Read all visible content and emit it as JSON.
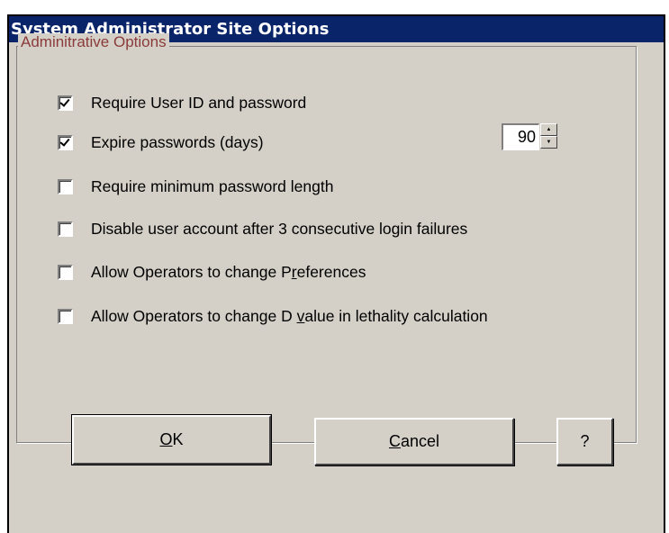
{
  "window": {
    "title": "System Administrator Site Options"
  },
  "group": {
    "label": "Adminitrative Options"
  },
  "options": [
    {
      "label": "Require User ID and password",
      "checked": true
    },
    {
      "label": "Expire passwords (days)",
      "checked": true
    },
    {
      "label": "Require minimum password length",
      "checked": false
    },
    {
      "label": "Disable user account after 3 consecutive login failures",
      "checked": false
    },
    {
      "label_pre": "Allow Operators to change P",
      "label_u": "r",
      "label_post": "eferences",
      "checked": false
    },
    {
      "label_pre": "Allow Operators to change D ",
      "label_u": "v",
      "label_post": "alue in lethality calculation",
      "checked": false
    }
  ],
  "expire_days": {
    "value": "90"
  },
  "buttons": {
    "ok": {
      "u": "O",
      "rest": "K"
    },
    "cancel": {
      "u": "C",
      "rest": "ancel"
    },
    "help": "?"
  }
}
